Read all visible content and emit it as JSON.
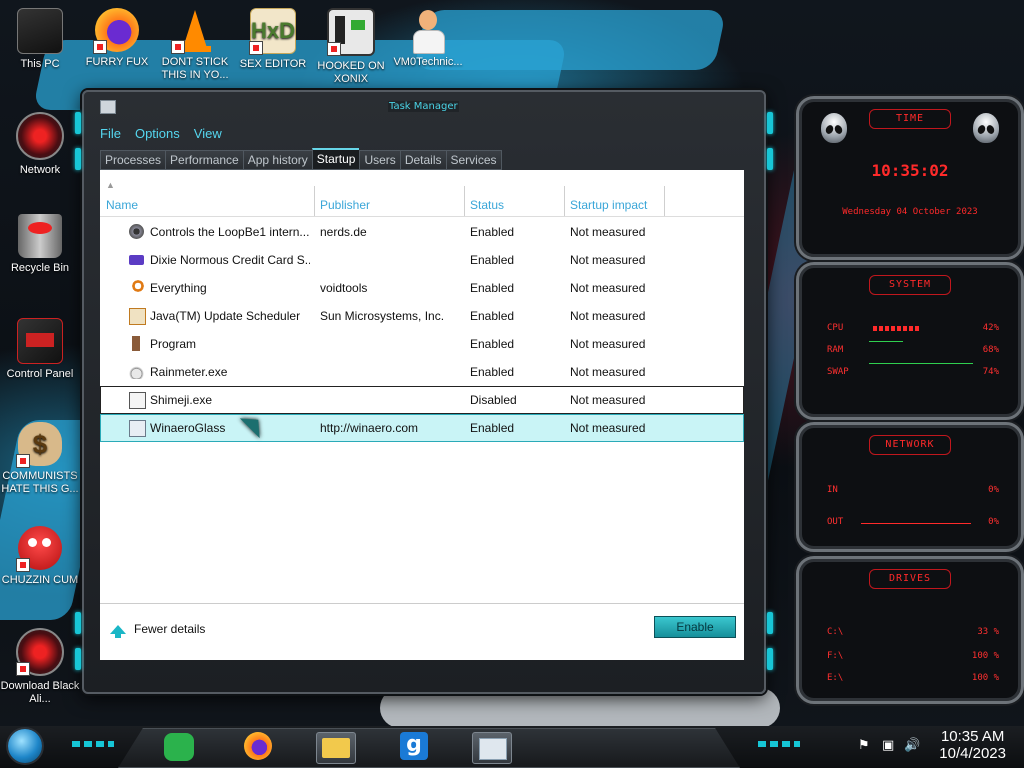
{
  "desktop": {
    "icons": [
      {
        "label": "This PC"
      },
      {
        "label": "FURRY FUX"
      },
      {
        "label": "DONT STICK THIS IN YO..."
      },
      {
        "label": "SEX EDITOR"
      },
      {
        "label": "HOOKED ON XONIX"
      },
      {
        "label": "VM0Technic..."
      },
      {
        "label": "Network"
      },
      {
        "label": "Recycle Bin"
      },
      {
        "label": "Control Panel"
      },
      {
        "label": "COMMUNISTS HATE THIS G..."
      },
      {
        "label": "CHUZZIN CUM"
      },
      {
        "label": "Download Black Ali..."
      }
    ]
  },
  "window": {
    "title": "Task Manager",
    "menu": [
      "File",
      "Options",
      "View"
    ],
    "tabs": [
      "Processes",
      "Performance",
      "App history",
      "Startup",
      "Users",
      "Details",
      "Services"
    ],
    "active_tab": "Startup",
    "columns": [
      "Name",
      "Publisher",
      "Status",
      "Startup impact"
    ],
    "rows": [
      {
        "name": "Controls the LoopBe1 intern...",
        "publisher": "nerds.de",
        "status": "Enabled",
        "impact": "Not measured",
        "icon": "loopbe-icon"
      },
      {
        "name": "Dixie Normous Credit Card S...",
        "publisher": "",
        "status": "Enabled",
        "impact": "Not measured",
        "icon": "credit-card-icon"
      },
      {
        "name": "Everything",
        "publisher": "voidtools",
        "status": "Enabled",
        "impact": "Not measured",
        "icon": "magnifier-icon"
      },
      {
        "name": "Java(TM) Update Scheduler",
        "publisher": "Sun Microsystems, Inc.",
        "status": "Enabled",
        "impact": "Not measured",
        "icon": "java-icon"
      },
      {
        "name": "Program",
        "publisher": "",
        "status": "Enabled",
        "impact": "Not measured",
        "icon": "program-icon"
      },
      {
        "name": "Rainmeter.exe",
        "publisher": "",
        "status": "Enabled",
        "impact": "Not measured",
        "icon": "droplet-icon"
      },
      {
        "name": "Shimeji.exe",
        "publisher": "",
        "status": "Disabled",
        "impact": "Not measured",
        "icon": "window-app-icon"
      },
      {
        "name": "WinaeroGlass",
        "publisher": "http://winaero.com",
        "status": "Enabled",
        "impact": "Not measured",
        "icon": "winaero-icon"
      }
    ],
    "fewer_details": "Fewer details",
    "enable_button": "Enable"
  },
  "widgets": {
    "time": {
      "title": "TIME",
      "clock": "10:35:02",
      "date": "Wednesday 04 October 2023"
    },
    "system": {
      "title": "SYSTEM",
      "rows": [
        {
          "label": "CPU",
          "value": "42%",
          "level": 0.42
        },
        {
          "label": "RAM",
          "value": "68%",
          "level": 0.68
        },
        {
          "label": "SWAP",
          "value": "74%",
          "level": 0.74
        }
      ]
    },
    "network": {
      "title": "NETWORK",
      "rows": [
        {
          "label": "IN",
          "value": "0%"
        },
        {
          "label": "OUT",
          "value": "0%"
        }
      ]
    },
    "drives": {
      "title": "DRIVES",
      "rows": [
        {
          "label": "C:\\",
          "value": "33 %",
          "level": 0.33
        },
        {
          "label": "F:\\",
          "value": "100 %",
          "level": 1.0
        },
        {
          "label": "E:\\",
          "value": "100 %",
          "level": 1.0
        }
      ]
    },
    "accent": "#ff2a2a"
  },
  "taskbar": {
    "time": "10:35 AM",
    "date": "10/4/2023"
  }
}
